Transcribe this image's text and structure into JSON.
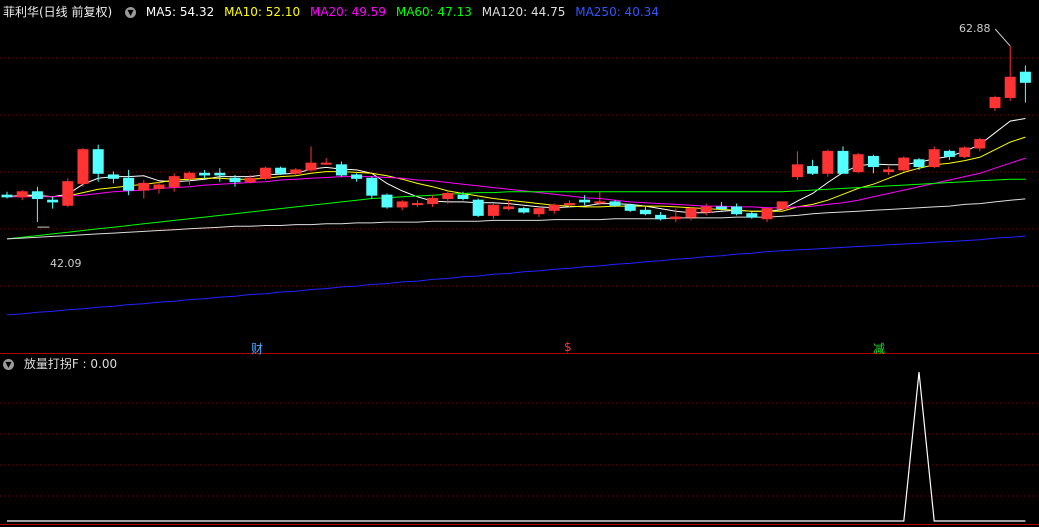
{
  "main_header": {
    "stock": "菲利华(日线 前复权)",
    "ma": [
      {
        "label": "MA5: 54.32",
        "color": "#ffffff"
      },
      {
        "label": "MA10: 52.10",
        "color": "#ffff00"
      },
      {
        "label": "MA20: 49.59",
        "color": "#ff00ff"
      },
      {
        "label": "MA60: 47.13",
        "color": "#00ff00"
      },
      {
        "label": "MA120: 44.75",
        "color": "#dddddd"
      },
      {
        "label": "MA250: 40.34",
        "color": "#2222ff"
      }
    ]
  },
  "sub_header": {
    "indicator": "放量打拐F : 0.00"
  },
  "markers": [
    {
      "text": "财",
      "color": "#4da6ff"
    },
    {
      "text": "$",
      "color": "#ff3333"
    },
    {
      "text": "减",
      "color": "#22dd22"
    }
  ],
  "annotations": {
    "high": "62.88",
    "low": "42.09"
  },
  "colors": {
    "up": "#ff3333",
    "down": "#54ffff",
    "grid": "#7a0000",
    "border": "#b00000"
  },
  "chart_data": {
    "type": "candlestick",
    "price_ylim": [
      28.0,
      66.0
    ],
    "ohlc": [
      [
        45.2,
        45.6,
        44.8,
        45.0
      ],
      [
        45.0,
        45.8,
        44.6,
        45.6
      ],
      [
        45.6,
        46.2,
        42.0,
        44.8
      ],
      [
        44.6,
        45.0,
        43.6,
        44.4
      ],
      [
        44.0,
        47.2,
        43.8,
        46.8
      ],
      [
        46.6,
        50.8,
        46.2,
        50.6
      ],
      [
        50.6,
        51.2,
        46.8,
        47.8
      ],
      [
        47.6,
        48.0,
        46.6,
        47.2
      ],
      [
        47.2,
        48.2,
        45.2,
        45.8
      ],
      [
        45.8,
        47.0,
        44.8,
        46.6
      ],
      [
        46.0,
        46.8,
        45.4,
        46.4
      ],
      [
        46.2,
        47.8,
        45.6,
        47.4
      ],
      [
        47.2,
        48.0,
        46.4,
        47.8
      ],
      [
        47.8,
        48.2,
        47.2,
        47.6
      ],
      [
        47.8,
        48.4,
        46.8,
        47.6
      ],
      [
        47.2,
        47.6,
        46.2,
        46.8
      ],
      [
        46.8,
        47.6,
        46.6,
        47.2
      ],
      [
        47.2,
        48.6,
        47.0,
        48.4
      ],
      [
        48.4,
        48.6,
        47.6,
        47.8
      ],
      [
        47.8,
        48.4,
        47.6,
        48.2
      ],
      [
        48.2,
        51.0,
        48.0,
        49.0
      ],
      [
        49.0,
        49.6,
        48.8,
        49.0
      ],
      [
        48.8,
        49.2,
        47.4,
        47.6
      ],
      [
        47.6,
        47.8,
        46.8,
        47.2
      ],
      [
        47.2,
        47.4,
        44.8,
        45.2
      ],
      [
        45.2,
        45.4,
        43.6,
        43.8
      ],
      [
        43.8,
        44.6,
        43.4,
        44.4
      ],
      [
        44.2,
        44.6,
        43.8,
        44.2
      ],
      [
        44.2,
        45.2,
        43.8,
        44.8
      ],
      [
        44.8,
        45.6,
        44.2,
        45.4
      ],
      [
        45.2,
        45.6,
        44.6,
        44.8
      ],
      [
        44.6,
        44.8,
        42.6,
        42.8
      ],
      [
        42.8,
        44.2,
        42.4,
        44.0
      ],
      [
        43.6,
        44.6,
        43.4,
        43.8
      ],
      [
        43.6,
        43.8,
        43.0,
        43.2
      ],
      [
        43.0,
        43.8,
        42.6,
        43.6
      ],
      [
        43.4,
        44.2,
        43.0,
        44.0
      ],
      [
        44.2,
        44.6,
        43.8,
        44.2
      ],
      [
        44.6,
        45.2,
        44.0,
        44.4
      ],
      [
        44.4,
        45.6,
        44.0,
        44.4
      ],
      [
        44.4,
        44.6,
        43.8,
        44.0
      ],
      [
        44.0,
        44.2,
        43.2,
        43.4
      ],
      [
        43.4,
        43.8,
        42.8,
        43.0
      ],
      [
        42.8,
        43.2,
        42.2,
        42.4
      ],
      [
        42.4,
        43.6,
        42.0,
        42.6
      ],
      [
        42.6,
        43.8,
        42.2,
        43.6
      ],
      [
        43.2,
        44.2,
        42.8,
        43.8
      ],
      [
        43.8,
        44.4,
        43.4,
        43.6
      ],
      [
        43.8,
        44.2,
        42.8,
        43.0
      ],
      [
        43.0,
        43.2,
        42.4,
        42.6
      ],
      [
        42.4,
        43.6,
        42.0,
        43.6
      ],
      [
        43.6,
        44.4,
        43.4,
        44.4
      ],
      [
        47.4,
        50.4,
        47.0,
        48.8
      ],
      [
        48.6,
        49.4,
        47.6,
        47.8
      ],
      [
        47.8,
        50.6,
        47.4,
        50.4
      ],
      [
        50.4,
        51.0,
        47.8,
        47.8
      ],
      [
        48.0,
        50.2,
        47.8,
        50.0
      ],
      [
        49.8,
        50.0,
        47.8,
        48.6
      ],
      [
        48.0,
        48.6,
        47.6,
        48.2
      ],
      [
        48.2,
        49.8,
        48.0,
        49.6
      ],
      [
        49.4,
        49.6,
        48.2,
        48.6
      ],
      [
        48.6,
        51.0,
        48.4,
        50.6
      ],
      [
        50.4,
        50.6,
        49.4,
        49.8
      ],
      [
        49.8,
        51.0,
        49.6,
        50.8
      ],
      [
        50.8,
        52.0,
        50.4,
        51.8
      ],
      [
        55.6,
        57.0,
        55.2,
        56.8
      ],
      [
        56.8,
        62.9,
        56.4,
        59.2
      ],
      [
        59.8,
        60.6,
        56.2,
        58.6
      ]
    ],
    "ma": [
      {
        "name": "MA5",
        "color": "#ffffff",
        "values": [
          45.0,
          45.2,
          45.2,
          45.0,
          45.3,
          46.5,
          47.2,
          47.4,
          47.4,
          47.5,
          46.9,
          46.8,
          46.9,
          47.1,
          47.4,
          47.4,
          47.4,
          47.6,
          47.7,
          47.8,
          48.3,
          48.5,
          48.3,
          48.2,
          47.8,
          46.6,
          45.7,
          45.0,
          44.5,
          44.4,
          44.4,
          44.3,
          44.3,
          44.2,
          44.0,
          43.8,
          43.7,
          43.8,
          43.9,
          44.2,
          44.2,
          44.1,
          43.9,
          43.6,
          43.3,
          43.1,
          43.1,
          43.3,
          43.4,
          43.3,
          43.3,
          43.5,
          44.5,
          45.4,
          46.7,
          47.9,
          48.7,
          48.9,
          48.8,
          48.8,
          49.1,
          49.5,
          49.8,
          50.4,
          51.2,
          52.6,
          54.0,
          54.3
        ]
      },
      {
        "name": "MA10",
        "color": "#ffff00",
        "values": [
          45.0,
          45.1,
          45.1,
          45.0,
          45.1,
          45.5,
          45.9,
          46.1,
          46.3,
          46.5,
          46.7,
          47.0,
          47.1,
          47.2,
          47.2,
          47.1,
          47.1,
          47.2,
          47.4,
          47.5,
          47.8,
          48.0,
          48.0,
          47.9,
          47.8,
          47.5,
          47.1,
          46.6,
          46.2,
          45.7,
          45.4,
          45.1,
          44.8,
          44.6,
          44.4,
          44.2,
          44.0,
          43.9,
          43.8,
          43.8,
          43.9,
          43.9,
          43.9,
          43.9,
          43.8,
          43.7,
          43.6,
          43.5,
          43.4,
          43.3,
          43.3,
          43.3,
          43.8,
          44.1,
          44.6,
          45.3,
          46.0,
          46.5,
          47.2,
          47.9,
          48.4,
          48.8,
          49.0,
          49.3,
          49.7,
          50.6,
          51.5,
          52.1
        ]
      },
      {
        "name": "MA20",
        "color": "#ff00ff",
        "values": [
          45.0,
          45.0,
          45.0,
          45.0,
          45.1,
          45.2,
          45.4,
          45.6,
          45.7,
          45.8,
          46.0,
          46.1,
          46.2,
          46.4,
          46.5,
          46.6,
          46.7,
          46.8,
          47.0,
          47.1,
          47.2,
          47.3,
          47.4,
          47.4,
          47.4,
          47.3,
          47.2,
          47.0,
          46.9,
          46.7,
          46.5,
          46.3,
          46.1,
          45.9,
          45.7,
          45.5,
          45.3,
          45.1,
          44.9,
          44.8,
          44.6,
          44.4,
          44.3,
          44.2,
          44.1,
          44.0,
          43.9,
          43.9,
          43.8,
          43.8,
          43.7,
          43.7,
          43.8,
          43.9,
          44.1,
          44.3,
          44.6,
          45.0,
          45.4,
          45.8,
          46.2,
          46.6,
          47.0,
          47.4,
          47.8,
          48.4,
          49.0,
          49.6
        ]
      },
      {
        "name": "MA60",
        "color": "#00ff00",
        "values": [
          40.0,
          40.2,
          40.4,
          40.6,
          40.8,
          41.0,
          41.2,
          41.4,
          41.6,
          41.8,
          42.0,
          42.2,
          42.4,
          42.6,
          42.8,
          43.0,
          43.2,
          43.4,
          43.6,
          43.8,
          44.0,
          44.2,
          44.4,
          44.6,
          44.8,
          44.9,
          45.0,
          45.1,
          45.2,
          45.3,
          45.4,
          45.5,
          45.5,
          45.6,
          45.6,
          45.6,
          45.6,
          45.6,
          45.6,
          45.6,
          45.6,
          45.6,
          45.6,
          45.6,
          45.6,
          45.6,
          45.6,
          45.6,
          45.6,
          45.6,
          45.6,
          45.6,
          45.7,
          45.8,
          45.9,
          46.0,
          46.1,
          46.2,
          46.3,
          46.4,
          46.5,
          46.6,
          46.7,
          46.8,
          46.9,
          47.0,
          47.1,
          47.1
        ]
      },
      {
        "name": "MA120",
        "color": "#dddddd",
        "values": [
          40.0,
          40.1,
          40.2,
          40.3,
          40.4,
          40.5,
          40.6,
          40.7,
          40.8,
          40.9,
          41.0,
          41.1,
          41.2,
          41.3,
          41.4,
          41.5,
          41.5,
          41.6,
          41.6,
          41.7,
          41.7,
          41.8,
          41.8,
          41.9,
          41.9,
          42.0,
          42.0,
          42.0,
          42.1,
          42.1,
          42.1,
          42.1,
          42.2,
          42.2,
          42.2,
          42.2,
          42.3,
          42.3,
          42.3,
          42.3,
          42.4,
          42.4,
          42.4,
          42.4,
          42.5,
          42.5,
          42.5,
          42.5,
          42.6,
          42.6,
          42.6,
          42.7,
          42.8,
          43.0,
          43.1,
          43.2,
          43.3,
          43.4,
          43.5,
          43.6,
          43.7,
          43.8,
          43.9,
          44.1,
          44.2,
          44.4,
          44.6,
          44.75
        ]
      },
      {
        "name": "MA250",
        "color": "#2222ff",
        "values": [
          31.0,
          31.1,
          31.3,
          31.4,
          31.6,
          31.7,
          31.9,
          32.0,
          32.2,
          32.3,
          32.5,
          32.6,
          32.8,
          32.9,
          33.1,
          33.2,
          33.4,
          33.5,
          33.7,
          33.8,
          34.0,
          34.1,
          34.3,
          34.4,
          34.6,
          34.7,
          34.9,
          35.0,
          35.2,
          35.3,
          35.5,
          35.6,
          35.8,
          35.9,
          36.1,
          36.2,
          36.4,
          36.5,
          36.7,
          36.8,
          37.0,
          37.1,
          37.3,
          37.4,
          37.6,
          37.7,
          37.9,
          38.0,
          38.2,
          38.3,
          38.5,
          38.6,
          38.7,
          38.8,
          38.9,
          39.0,
          39.1,
          39.2,
          39.3,
          39.4,
          39.5,
          39.6,
          39.7,
          39.8,
          39.9,
          40.1,
          40.2,
          40.34
        ]
      }
    ],
    "indicator": {
      "name": "放量打拐F",
      "ylim": [
        0,
        1
      ],
      "values": [
        0,
        0,
        0,
        0,
        0,
        0,
        0,
        0,
        0,
        0,
        0,
        0,
        0,
        0,
        0,
        0,
        0,
        0,
        0,
        0,
        0,
        0,
        0,
        0,
        0,
        0,
        0,
        0,
        0,
        0,
        0,
        0,
        0,
        0,
        0,
        0,
        0,
        0,
        0,
        0,
        0,
        0,
        0,
        0,
        0,
        0,
        0,
        0,
        0,
        0,
        0,
        0,
        0,
        0,
        0,
        0,
        0,
        0,
        0,
        0,
        1,
        0,
        0,
        0,
        0,
        0,
        0,
        0
      ]
    }
  }
}
